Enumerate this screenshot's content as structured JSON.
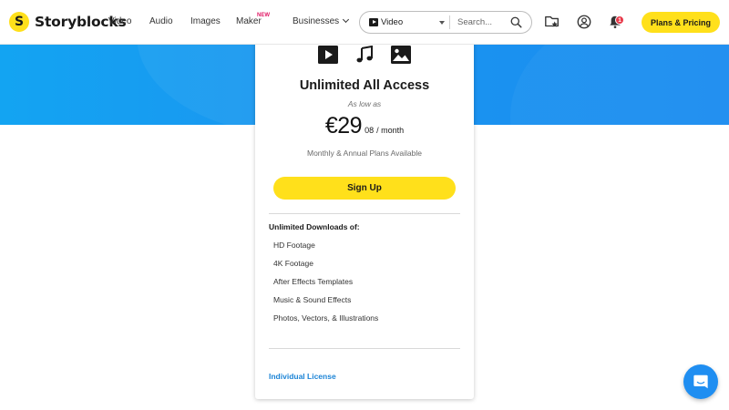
{
  "header": {
    "logo_badge": "S",
    "logo_text": "Storyblocks",
    "nav": {
      "video": "Video",
      "audio": "Audio",
      "images": "Images",
      "maker": "Maker",
      "maker_badge": "NEW",
      "businesses": "Businesses"
    },
    "search": {
      "type_label": "Video",
      "placeholder": "Search..."
    },
    "notification_count": "1",
    "plans_button": "Plans & Pricing"
  },
  "card": {
    "icons": [
      "video-play-icon",
      "music-note-icon",
      "image-icon"
    ],
    "title": "Unlimited All Access",
    "as_low_as": "As low as",
    "price_main": "€29",
    "price_cents": "08",
    "price_period": "/ month",
    "plans_note": "Monthly & Annual Plans Available",
    "signup_button": "Sign Up",
    "downloads_heading": "Unlimited Downloads of:",
    "features": [
      "HD Footage",
      "4K Footage",
      "After Effects Templates",
      "Music & Sound Effects",
      "Photos, Vectors, & Illustrations"
    ],
    "license_link": "Individual License"
  },
  "colors": {
    "brand_yellow": "#ffe01b",
    "hero_blue": "#1b8cf0",
    "link_blue": "#1c84d6",
    "badge_red": "#e8394a",
    "maker_new": "#e01865"
  },
  "chat_icon": "chat-bubble-icon"
}
